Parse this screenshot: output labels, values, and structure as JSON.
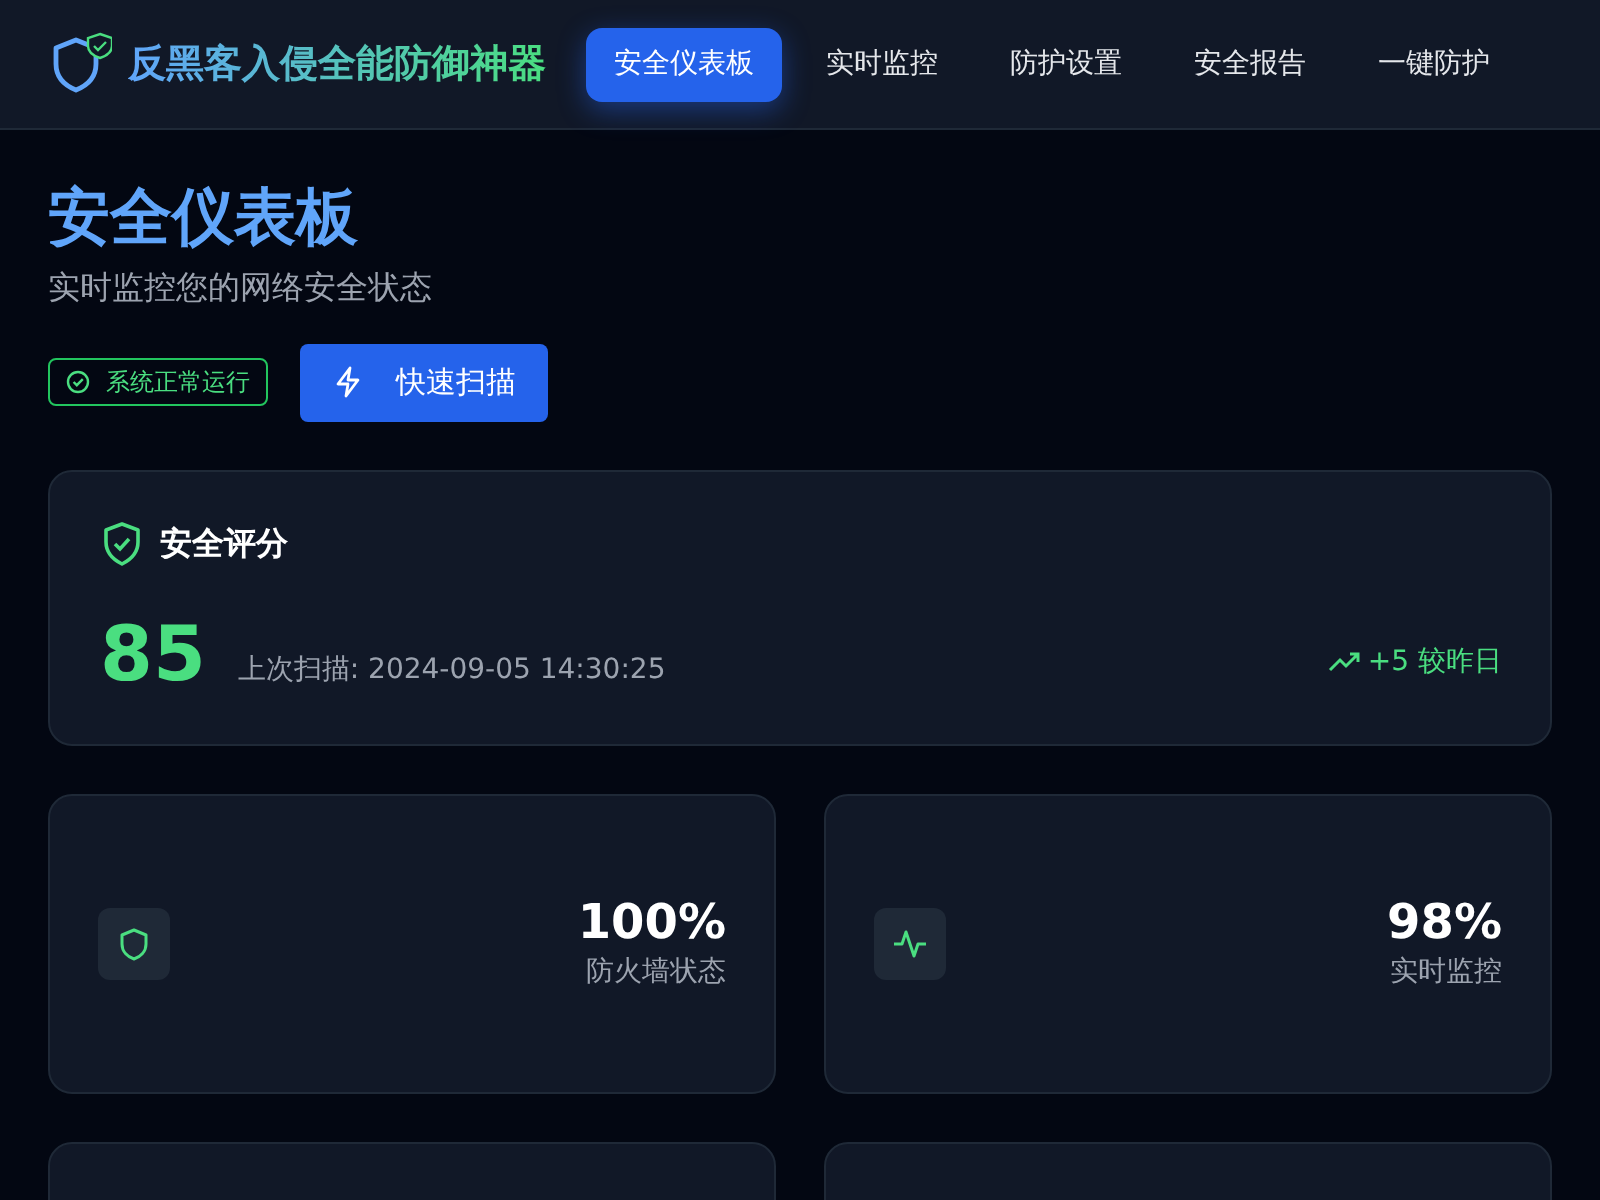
{
  "app": {
    "title": "反黑客入侵全能防御神器"
  },
  "nav": [
    {
      "label": "安全仪表板",
      "selected": true
    },
    {
      "label": "实时监控",
      "selected": false
    },
    {
      "label": "防护设置",
      "selected": false
    },
    {
      "label": "安全报告",
      "selected": false
    },
    {
      "label": "一键防护",
      "selected": false
    }
  ],
  "header": {
    "title": "安全仪表板",
    "subtitle": "实时监控您的网络安全状态",
    "status_badge": "系统正常运行",
    "scan_button": "快速扫描"
  },
  "score_card": {
    "title": "安全评分",
    "score": "85",
    "last_scan": "上次扫描: 2024-09-05 14:30:25",
    "trend": "+5 较昨日"
  },
  "stats": [
    {
      "kind": "shield",
      "value": "100%",
      "label": "防火墙状态"
    },
    {
      "kind": "pulse",
      "value": "98%",
      "label": "实时监控"
    }
  ]
}
